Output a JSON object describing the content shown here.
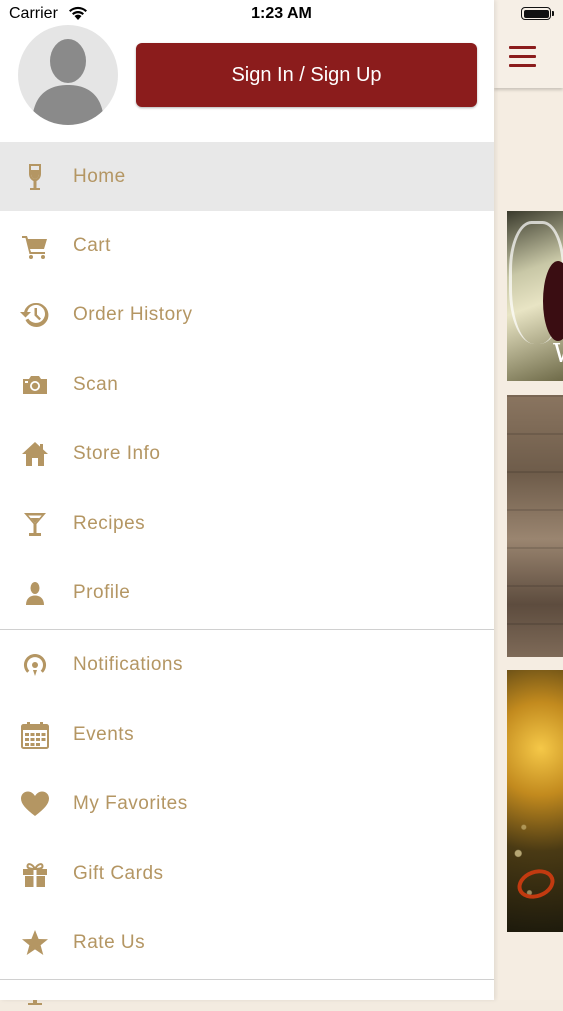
{
  "status_bar": {
    "carrier": "Carrier",
    "time": "1:23 AM"
  },
  "header": {
    "signin_label": "Sign In / Sign Up"
  },
  "menu": {
    "group1": [
      {
        "label": "Home",
        "icon": "wine-glass-icon",
        "active": true
      },
      {
        "label": "Cart",
        "icon": "cart-icon"
      },
      {
        "label": "Order History",
        "icon": "history-icon"
      },
      {
        "label": "Scan",
        "icon": "camera-icon"
      },
      {
        "label": "Store Info",
        "icon": "house-icon"
      },
      {
        "label": "Recipes",
        "icon": "cocktail-glass-icon"
      },
      {
        "label": "Profile",
        "icon": "person-icon"
      }
    ],
    "group2": [
      {
        "label": "Notifications",
        "icon": "broadcast-icon"
      },
      {
        "label": "Events",
        "icon": "calendar-icon"
      },
      {
        "label": "My Favorites",
        "icon": "heart-icon"
      },
      {
        "label": "Gift Cards",
        "icon": "gift-icon"
      },
      {
        "label": "Rate Us",
        "icon": "star-icon"
      }
    ]
  },
  "background": {
    "card1_text": "W"
  },
  "colors": {
    "accent": "#8b1c1c",
    "icon": "#b49663",
    "label": "#b49663",
    "active_row": "#e8e8e8"
  }
}
